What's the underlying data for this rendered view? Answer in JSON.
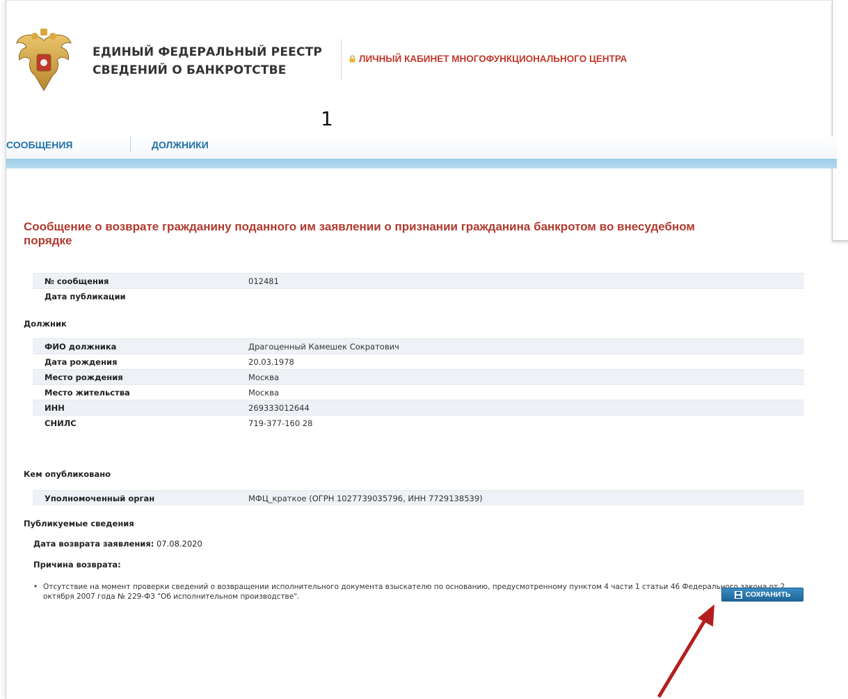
{
  "header": {
    "registry_title_line1": "ЕДИНЫЙ ФЕДЕРАЛЬНЫЙ РЕЕСТР",
    "registry_title_line2": "СВЕДЕНИЙ О БАНКРОТСТВЕ",
    "cabinet_label": "ЛИЧНЫЙ КАБИНЕТ МНОГОФУНКЦИОНАЛЬНОГО ЦЕНТРА",
    "annotation_number": "1"
  },
  "nav": {
    "items": [
      {
        "label": "СООБЩЕНИЯ"
      },
      {
        "label": "ДОЛЖНИКИ"
      }
    ]
  },
  "page_title": "Сообщение о возврате гражданину поданного им заявлении о признании гражданина банкротом во внесудебном порядке",
  "message_info": [
    {
      "label": "№ сообщения",
      "value": "012481"
    },
    {
      "label": "Дата публикации",
      "value": ""
    }
  ],
  "debtor": {
    "section_title": "Должник",
    "rows": [
      {
        "label": "ФИО должника",
        "value": "Драгоценный Камешек Сократович"
      },
      {
        "label": "Дата рождения",
        "value": "20.03.1978"
      },
      {
        "label": "Место рождения",
        "value": "Москва"
      },
      {
        "label": "Место жительства",
        "value": "Москва"
      },
      {
        "label": "ИНН",
        "value": "269333012644"
      },
      {
        "label": "СНИЛС",
        "value": "719-377-160 28"
      }
    ]
  },
  "publisher": {
    "section_title": "Кем опубликовано",
    "rows": [
      {
        "label": "Уполномоченный орган",
        "value": "МФЦ_краткое  (ОГРН 1027739035796,  ИНН 7729138539)"
      }
    ]
  },
  "published": {
    "section_title": "Публикуемые сведения",
    "return_date_label": "Дата возврата заявления:",
    "return_date_value": "07.08.2020",
    "reason_label": "Причина возврата:",
    "reason_text": "Отсутствие на момент проверки сведений о возвращении исполнительного документа взыскателю по основанию, предусмотренному пунктом 4 части 1 статьи 46 Федерального закона от 2 октября 2007 года № 229-ФЗ \"Об исполнительном производстве\"."
  },
  "actions": {
    "save_label": "СОХРАНИТЬ"
  },
  "colors": {
    "accent_red": "#b03a2e",
    "nav_blue": "#1f6fa8",
    "button_blue": "#2a78b0",
    "annotation_arrow": "#b41e1e"
  }
}
